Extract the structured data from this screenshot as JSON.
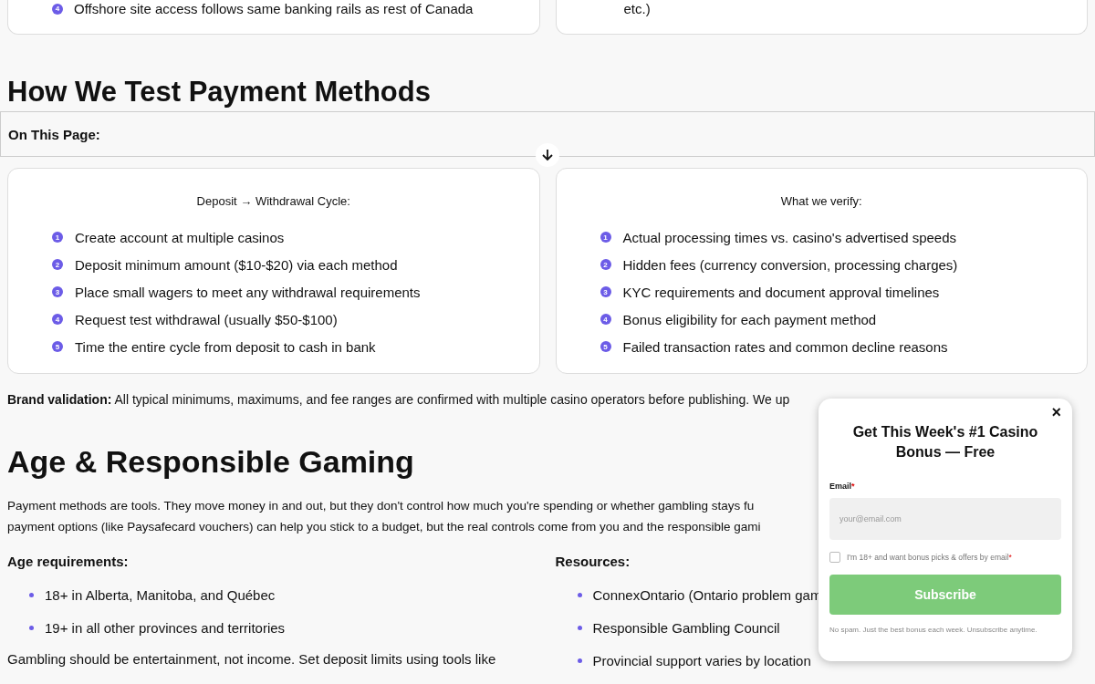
{
  "top_cards": [
    {
      "items": [
        {
          "number": "4",
          "text": "Offshore site access follows same banking rails as rest of Canada"
        }
      ]
    },
    {
      "items": [
        {
          "text": "etc.)"
        }
      ]
    }
  ],
  "test_section": {
    "heading": "How We Test Payment Methods",
    "cards": [
      {
        "title": "Deposit → Withdrawal Cycle:",
        "items": [
          {
            "number": "1",
            "text": "Create account at multiple casinos"
          },
          {
            "number": "2",
            "text": "Deposit minimum amount ($10-$20) via each method"
          },
          {
            "number": "3",
            "text": "Place small wagers to meet any withdrawal requirements"
          },
          {
            "number": "4",
            "text": "Request test withdrawal (usually $50-$100)"
          },
          {
            "number": "5",
            "text": "Time the entire cycle from deposit to cash in bank"
          }
        ]
      },
      {
        "title": "What we verify:",
        "items": [
          {
            "number": "1",
            "text": "Actual processing times vs. casino's advertised speeds"
          },
          {
            "number": "2",
            "text": "Hidden fees (currency conversion, processing charges)"
          },
          {
            "number": "3",
            "text": "KYC requirements and document approval timelines"
          },
          {
            "number": "4",
            "text": "Bonus eligibility for each payment method"
          },
          {
            "number": "5",
            "text": "Failed transaction rates and common decline reasons"
          }
        ]
      }
    ],
    "note": "**Brand validation:** All typical minimums, maximums, and fee ranges are confirmed with multiple casino operators before publishing. We up"
  },
  "on_this_page": {
    "label": "On This Page:"
  },
  "age_section": {
    "heading": "Age & Responsible Gaming",
    "paragraph_lines": [
      "Payment methods are tools. They move money in and out, but they don't control how much you're spending or whether gambling stays fu",
      "payment options (like Paysafecard vouchers) can help you stick to a budget, but the real controls come from you and the responsible gami"
    ],
    "columns": [
      {
        "title": "Age requirements:",
        "items": [
          "18+ in Alberta, Manitoba, and Québec",
          "19+ in all other provinces and territories"
        ],
        "after": "Gambling should be entertainment, not income. Set deposit limits using tools like"
      },
      {
        "title": "Resources:",
        "items": [
          "ConnexOntario (Ontario problem gam",
          "Responsible Gambling Council",
          "Provincial support varies by location"
        ]
      }
    ]
  },
  "popup": {
    "close": "×",
    "title": "Get This Week's #1 Casino Bonus — Free",
    "email_label": "Email",
    "required_mark": "*",
    "email_placeholder": "your@email.com",
    "consent": {
      "label": "I'm 18+ and want bonus picks & offers by email",
      "checked": false
    },
    "button": "Subscribe",
    "footnote": "No spam. Just the best bonus each week. Unsubscribe anytime."
  }
}
